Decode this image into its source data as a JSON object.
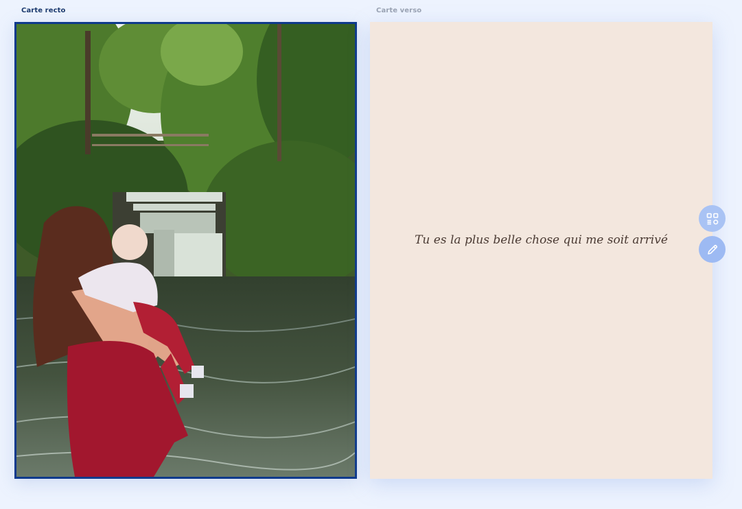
{
  "front": {
    "label": "Carte recto",
    "photo_icon": "photo-mother-baby-waterfall"
  },
  "back": {
    "label": "Carte verso",
    "message": "Tu es la plus belle chose qui me soit arrivé"
  },
  "tools": {
    "layout_icon": "layout-grid-icon",
    "edit_icon": "pencil-icon"
  },
  "colors": {
    "page_bg": "#edf3fe",
    "front_border": "#0f3a8c",
    "back_bg": "#f3e7de",
    "fab_bg": "#a9c3f4"
  }
}
